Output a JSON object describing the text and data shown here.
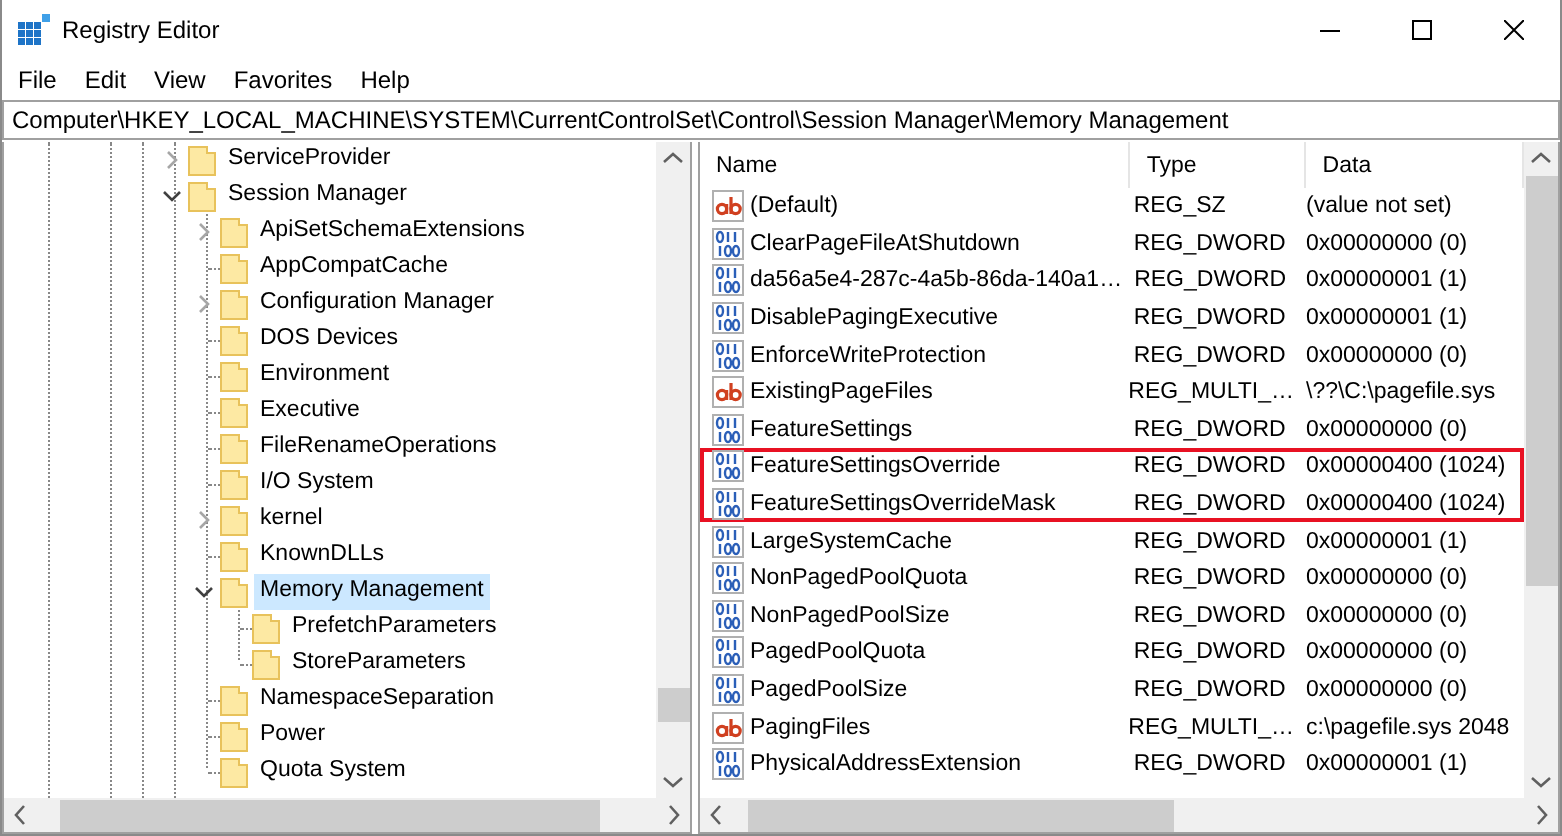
{
  "window": {
    "title": "Registry Editor"
  },
  "menu": [
    "File",
    "Edit",
    "View",
    "Favorites",
    "Help"
  ],
  "address_bar": {
    "value": "Computer\\HKEY_LOCAL_MACHINE\\SYSTEM\\CurrentControlSet\\Control\\Session Manager\\Memory Management"
  },
  "tree": [
    {
      "label": "ServiceProvider",
      "kind": "branch",
      "expanded": false,
      "selected": false
    },
    {
      "label": "Session Manager",
      "kind": "branch",
      "expanded": true,
      "selected": false,
      "children": [
        {
          "label": "ApiSetSchemaExtensions",
          "kind": "branch",
          "expanded": false,
          "selected": false
        },
        {
          "label": "AppCompatCache",
          "kind": "leaf",
          "selected": false
        },
        {
          "label": "Configuration Manager",
          "kind": "branch",
          "expanded": false,
          "selected": false
        },
        {
          "label": "DOS Devices",
          "kind": "leaf",
          "selected": false
        },
        {
          "label": "Environment",
          "kind": "leaf",
          "selected": false
        },
        {
          "label": "Executive",
          "kind": "leaf",
          "selected": false
        },
        {
          "label": "FileRenameOperations",
          "kind": "leaf",
          "selected": false
        },
        {
          "label": "I/O System",
          "kind": "leaf",
          "selected": false
        },
        {
          "label": "kernel",
          "kind": "branch",
          "expanded": false,
          "selected": false
        },
        {
          "label": "KnownDLLs",
          "kind": "leaf",
          "selected": false
        },
        {
          "label": "Memory Management",
          "kind": "branch",
          "expanded": true,
          "selected": true,
          "children": [
            {
              "label": "PrefetchParameters",
              "kind": "leaf",
              "selected": false
            },
            {
              "label": "StoreParameters",
              "kind": "leaf",
              "selected": false
            }
          ]
        },
        {
          "label": "NamespaceSeparation",
          "kind": "leaf",
          "selected": false
        },
        {
          "label": "Power",
          "kind": "leaf",
          "selected": false
        },
        {
          "label": "Quota System",
          "kind": "leaf",
          "selected": false
        }
      ]
    }
  ],
  "table": {
    "columns": [
      "Name",
      "Type",
      "Data"
    ],
    "rows": [
      {
        "kind": "string",
        "name": "(Default)",
        "type": "REG_SZ",
        "data": "(value not set)",
        "highlighted": false
      },
      {
        "kind": "dword",
        "name": "ClearPageFileAtShutdown",
        "type": "REG_DWORD",
        "data": "0x00000000 (0)",
        "highlighted": false
      },
      {
        "kind": "dword",
        "name": "da56a5e4-287c-4a5b-86da-140a1…",
        "type": "REG_DWORD",
        "data": "0x00000001 (1)",
        "highlighted": false
      },
      {
        "kind": "dword",
        "name": "DisablePagingExecutive",
        "type": "REG_DWORD",
        "data": "0x00000001 (1)",
        "highlighted": false
      },
      {
        "kind": "dword",
        "name": "EnforceWriteProtection",
        "type": "REG_DWORD",
        "data": "0x00000000 (0)",
        "highlighted": false
      },
      {
        "kind": "string",
        "name": "ExistingPageFiles",
        "type": "REG_MULTI_…",
        "data": "\\??\\C:\\pagefile.sys",
        "highlighted": false
      },
      {
        "kind": "dword",
        "name": "FeatureSettings",
        "type": "REG_DWORD",
        "data": "0x00000000 (0)",
        "highlighted": false
      },
      {
        "kind": "dword",
        "name": "FeatureSettingsOverride",
        "type": "REG_DWORD",
        "data": "0x00000400 (1024)",
        "highlighted": true
      },
      {
        "kind": "dword",
        "name": "FeatureSettingsOverrideMask",
        "type": "REG_DWORD",
        "data": "0x00000400 (1024)",
        "highlighted": true
      },
      {
        "kind": "dword",
        "name": "LargeSystemCache",
        "type": "REG_DWORD",
        "data": "0x00000001 (1)",
        "highlighted": false
      },
      {
        "kind": "dword",
        "name": "NonPagedPoolQuota",
        "type": "REG_DWORD",
        "data": "0x00000000 (0)",
        "highlighted": false
      },
      {
        "kind": "dword",
        "name": "NonPagedPoolSize",
        "type": "REG_DWORD",
        "data": "0x00000000 (0)",
        "highlighted": false
      },
      {
        "kind": "dword",
        "name": "PagedPoolQuota",
        "type": "REG_DWORD",
        "data": "0x00000000 (0)",
        "highlighted": false
      },
      {
        "kind": "dword",
        "name": "PagedPoolSize",
        "type": "REG_DWORD",
        "data": "0x00000000 (0)",
        "highlighted": false
      },
      {
        "kind": "string",
        "name": "PagingFiles",
        "type": "REG_MULTI_…",
        "data": "c:\\pagefile.sys 2048",
        "highlighted": false
      },
      {
        "kind": "dword",
        "name": "PhysicalAddressExtension",
        "type": "REG_DWORD",
        "data": "0x00000001 (1)",
        "highlighted": false
      }
    ]
  }
}
